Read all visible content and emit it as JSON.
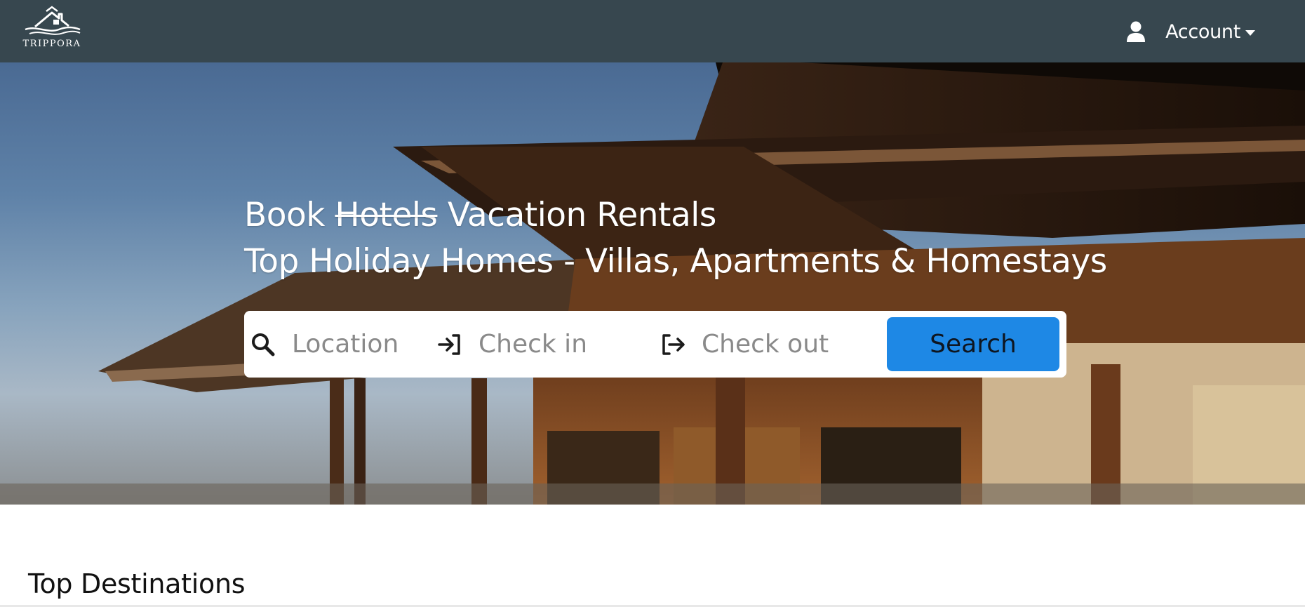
{
  "header": {
    "logo_text": "TRIPPORA",
    "account_label": "Account",
    "icons": {
      "logo": "house-waves-logo",
      "user": "user-icon",
      "caret": "caret-down-icon"
    }
  },
  "hero": {
    "headline_line1_prefix": "Book ",
    "headline_struck_word": "Hotels",
    "headline_line1_suffix": " Vacation Rentals",
    "headline_line2": "Top Holiday Homes - Villas, Apartments & Homestays"
  },
  "search": {
    "location_placeholder": "Location",
    "checkin_placeholder": "Check in",
    "checkout_placeholder": "Check out",
    "button_label": "Search",
    "icons": {
      "location": "search-icon",
      "checkin": "sign-in-icon",
      "checkout": "sign-out-icon"
    },
    "button_color": "#1e88e5"
  },
  "sections": {
    "top_destinations_title": "Top Destinations"
  },
  "colors": {
    "header_bg": "#37474f",
    "accent": "#1e88e5"
  }
}
